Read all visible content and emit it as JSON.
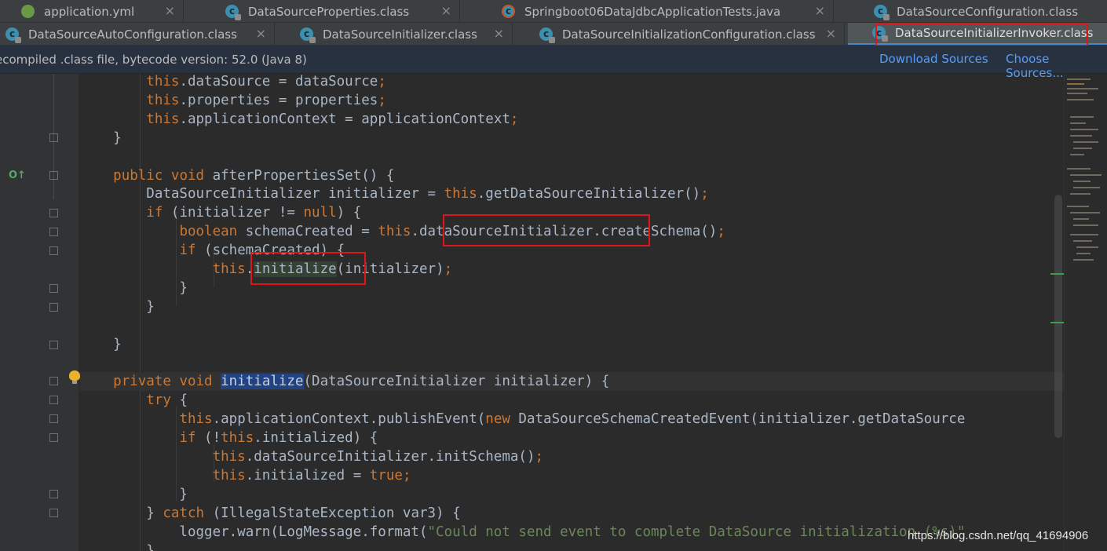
{
  "tabs_row1": [
    {
      "label": "application.yml",
      "icon": "yml-file-icon"
    },
    {
      "label": "DataSourceProperties.class",
      "icon": "class-file-icon"
    },
    {
      "label": "Springboot06DataJdbcApplicationTests.java",
      "icon": "java-test-file-icon"
    },
    {
      "label": "DataSourceConfiguration.class",
      "icon": "class-file-icon"
    }
  ],
  "tabs_row2": [
    {
      "label": "DataSourceAutoConfiguration.class",
      "icon": "class-file-icon"
    },
    {
      "label": "DataSourceInitializer.class",
      "icon": "class-file-icon"
    },
    {
      "label": "DataSourceInitializationConfiguration.class",
      "icon": "class-file-icon"
    },
    {
      "label": "DataSourceInitializerInvoker.class",
      "icon": "class-file-icon",
      "active": true
    }
  ],
  "close_glyph": "×",
  "class_icon_letter": "c",
  "infobar": {
    "message": "ecompiled .class file, bytecode version: 52.0 (Java 8)",
    "download_sources": "Download Sources",
    "choose_sources": "Choose Sources..."
  },
  "gutter": {
    "override_marker": "O↑"
  },
  "code_lines": [
    [
      {
        "t": "        "
      },
      {
        "t": "this",
        "k": "kw"
      },
      {
        "t": ".dataSource = dataSource"
      },
      {
        "t": ";",
        "k": "kw"
      }
    ],
    [
      {
        "t": "        "
      },
      {
        "t": "this",
        "k": "kw"
      },
      {
        "t": ".properties = properties"
      },
      {
        "t": ";",
        "k": "kw"
      }
    ],
    [
      {
        "t": "        "
      },
      {
        "t": "this",
        "k": "kw"
      },
      {
        "t": ".applicationContext = applicationContext"
      },
      {
        "t": ";",
        "k": "kw"
      }
    ],
    [
      {
        "t": "    }"
      }
    ],
    [
      {
        "t": ""
      }
    ],
    [
      {
        "t": "    "
      },
      {
        "t": "public void",
        "k": "kw"
      },
      {
        "t": " afterPropertiesSet() {"
      }
    ],
    [
      {
        "t": "        DataSourceInitializer initializer = "
      },
      {
        "t": "this",
        "k": "kw"
      },
      {
        "t": ".getDataSourceInitializer()"
      },
      {
        "t": ";",
        "k": "kw"
      }
    ],
    [
      {
        "t": "        "
      },
      {
        "t": "if",
        "k": "kw"
      },
      {
        "t": " (initializer != "
      },
      {
        "t": "null",
        "k": "kw"
      },
      {
        "t": ") {"
      }
    ],
    [
      {
        "t": "            "
      },
      {
        "t": "boolean",
        "k": "kw"
      },
      {
        "t": " schemaCreated = "
      },
      {
        "t": "this",
        "k": "kw"
      },
      {
        "t": ".dataSourceInitializer.createSchema()"
      },
      {
        "t": ";",
        "k": "kw"
      }
    ],
    [
      {
        "t": "            "
      },
      {
        "t": "if",
        "k": "kw"
      },
      {
        "t": " (schemaCreated) {"
      }
    ],
    [
      {
        "t": "                "
      },
      {
        "t": "this",
        "k": "kw"
      },
      {
        "t": "."
      },
      {
        "t": "initialize",
        "k": "hl2"
      },
      {
        "t": "(initializer)"
      },
      {
        "t": ";",
        "k": "kw"
      }
    ],
    [
      {
        "t": "            }"
      }
    ],
    [
      {
        "t": "        }"
      }
    ],
    [
      {
        "t": ""
      }
    ],
    [
      {
        "t": "    }"
      }
    ],
    [
      {
        "t": ""
      }
    ],
    [
      {
        "t": "    "
      },
      {
        "t": "private void",
        "k": "kw"
      },
      {
        "t": " "
      },
      {
        "t": "initialize",
        "k": "hl"
      },
      {
        "t": "(DataSourceInitializer initializer) {"
      }
    ],
    [
      {
        "t": "        "
      },
      {
        "t": "try",
        "k": "kw"
      },
      {
        "t": " {"
      }
    ],
    [
      {
        "t": "            "
      },
      {
        "t": "this",
        "k": "kw"
      },
      {
        "t": ".applicationContext.publishEvent("
      },
      {
        "t": "new",
        "k": "kw"
      },
      {
        "t": " DataSourceSchemaCreatedEvent(initializer.getDataSource"
      }
    ],
    [
      {
        "t": "            "
      },
      {
        "t": "if",
        "k": "kw"
      },
      {
        "t": " (!"
      },
      {
        "t": "this",
        "k": "kw"
      },
      {
        "t": ".initialized) {"
      }
    ],
    [
      {
        "t": "                "
      },
      {
        "t": "this",
        "k": "kw"
      },
      {
        "t": ".dataSourceInitializer.initSchema()"
      },
      {
        "t": ";",
        "k": "kw"
      }
    ],
    [
      {
        "t": "                "
      },
      {
        "t": "this",
        "k": "kw"
      },
      {
        "t": ".initialized = "
      },
      {
        "t": "true",
        "k": "kw"
      },
      {
        "t": ";",
        "k": "kw"
      }
    ],
    [
      {
        "t": "            }"
      }
    ],
    [
      {
        "t": "        } "
      },
      {
        "t": "catch",
        "k": "kw"
      },
      {
        "t": " (IllegalStateException var3) {"
      }
    ],
    [
      {
        "t": "            logger.warn(LogMessage.format("
      },
      {
        "t": "\"Could not send event to complete DataSource initialization (%s)\"",
        "k": "str"
      }
    ],
    [
      {
        "t": "        }"
      }
    ]
  ],
  "watermark": "https://blog.csdn.net/qq_41694906"
}
